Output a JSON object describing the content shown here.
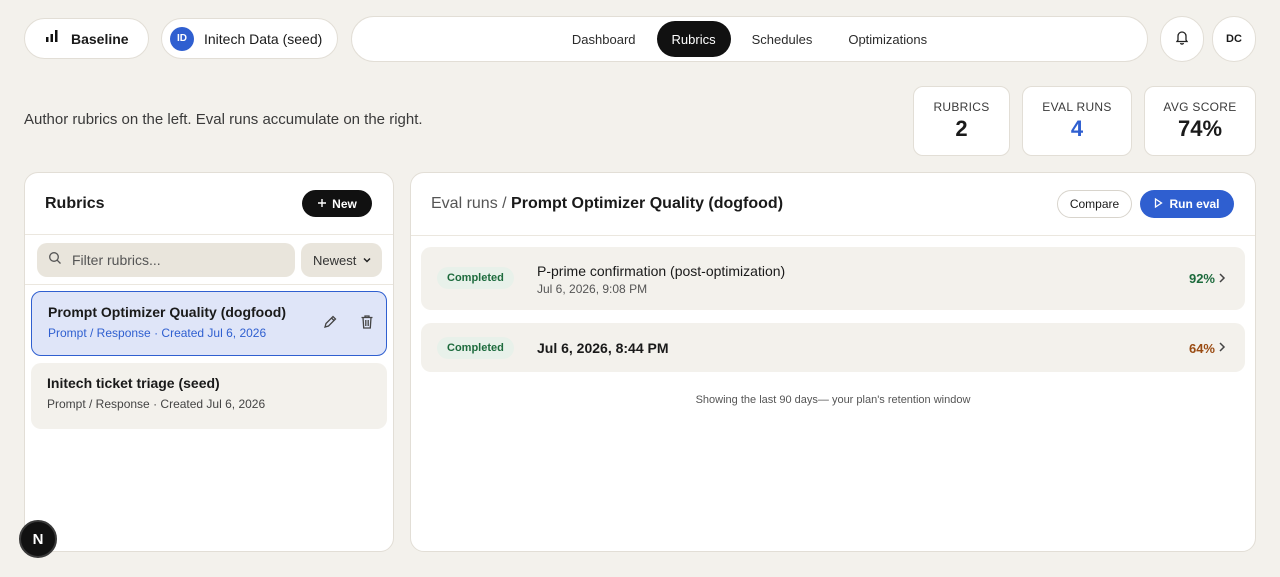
{
  "brand": {
    "label": "Baseline",
    "icon": "bar-chart-icon"
  },
  "workspace": {
    "initials": "ID",
    "name": "Initech Data (seed)"
  },
  "nav": {
    "tabs": [
      {
        "label": "Dashboard",
        "active": false
      },
      {
        "label": "Rubrics",
        "active": true
      },
      {
        "label": "Schedules",
        "active": false
      },
      {
        "label": "Optimizations",
        "active": false
      }
    ]
  },
  "header": {
    "bell_icon": "bell-icon",
    "user_initials": "DC"
  },
  "intro": "Author rubrics on the left. Eval runs accumulate on the right.",
  "stats": [
    {
      "label": "RUBRICS",
      "value": "2"
    },
    {
      "label": "EVAL RUNS",
      "value": "4"
    },
    {
      "label": "AVG SCORE",
      "value": "74%"
    }
  ],
  "rubrics_panel": {
    "title": "Rubrics",
    "new_button": "New",
    "search_placeholder": "Filter rubrics...",
    "sort_value": "Newest",
    "items": [
      {
        "name": "Prompt Optimizer Quality (dogfood)",
        "type": "Prompt / Response",
        "created": "Created Jul 6, 2026",
        "selected": true
      },
      {
        "name": "Initech ticket triage (seed)",
        "type": "Prompt / Response",
        "created": "Created Jul 6, 2026",
        "selected": false
      }
    ]
  },
  "runs_panel": {
    "breadcrumb_root": "Eval runs /",
    "breadcrumb_current": "Prompt Optimizer Quality (dogfood)",
    "compare_button": "Compare",
    "run_button": "Run eval",
    "runs": [
      {
        "status": "Completed",
        "title": "P-prime confirmation (post-optimization)",
        "date": "Jul 6, 2026, 9:08 PM",
        "score": "92%"
      },
      {
        "status": "Completed",
        "title": "Jul 6, 2026, 8:44 PM",
        "date": "",
        "score": "64%"
      }
    ],
    "retention_note": "Showing the last 90 days— your plan's retention window"
  },
  "dev_badge": "N",
  "colors": {
    "accent": "#2f5fd0",
    "success": "#1d6b3d",
    "warning": "#9a4b12",
    "background": "#f3f1ec"
  }
}
